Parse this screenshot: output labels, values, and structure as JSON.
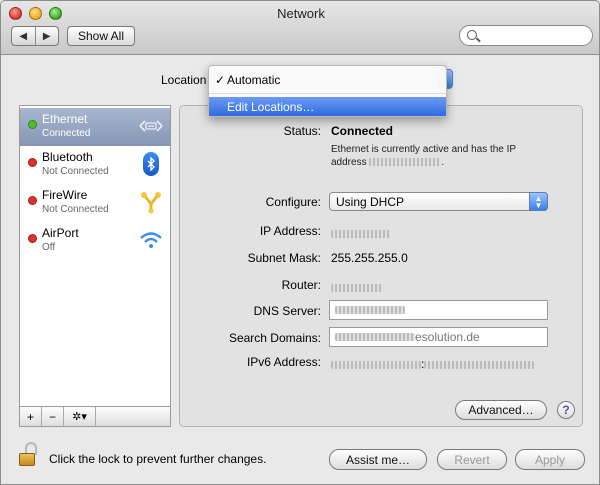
{
  "window": {
    "title": "Network"
  },
  "toolbar": {
    "show_all_label": "Show All",
    "back_glyph": "◀",
    "forward_glyph": "▶",
    "search_placeholder": ""
  },
  "location": {
    "label": "Location",
    "menu": {
      "check_glyph": "✓",
      "selected": "Automatic",
      "edit": "Edit Locations…"
    }
  },
  "services": [
    {
      "name": "Ethernet",
      "status": "Connected",
      "status_color": "#4cc02a",
      "icon": "ethernet-icon",
      "selected": true
    },
    {
      "name": "Bluetooth",
      "status": "Not Connected",
      "status_color": "#e0302a",
      "icon": "bluetooth-icon",
      "selected": false
    },
    {
      "name": "FireWire",
      "status": "Not Connected",
      "status_color": "#e0302a",
      "icon": "firewire-icon",
      "selected": false
    },
    {
      "name": "AirPort",
      "status": "Off",
      "status_color": "#e0302a",
      "icon": "airport-icon",
      "selected": false
    }
  ],
  "sidebar_footer": {
    "add": "+",
    "remove": "−",
    "action": "✲▾"
  },
  "detail": {
    "status_label": "Status:",
    "status_value": "Connected",
    "status_desc_line1": "Ethernet is currently active and has the IP",
    "status_desc_line2_prefix": "address",
    "configure_label": "Configure:",
    "configure_value": "Using DHCP",
    "ip_label": "IP Address:",
    "subnet_label": "Subnet Mask:",
    "subnet_value": "255.255.255.0",
    "router_label": "Router:",
    "dns_label": "DNS Server:",
    "search_domains_label": "Search Domains:",
    "search_domains_value": "esolution.de",
    "ipv6_label": "IPv6 Address:",
    "ipv6_sep": ":"
  },
  "buttons": {
    "advanced": "Advanced…",
    "help": "?",
    "assist": "Assist me…",
    "revert": "Revert",
    "apply": "Apply"
  },
  "lock": {
    "text": "Click the lock to prevent further changes."
  }
}
